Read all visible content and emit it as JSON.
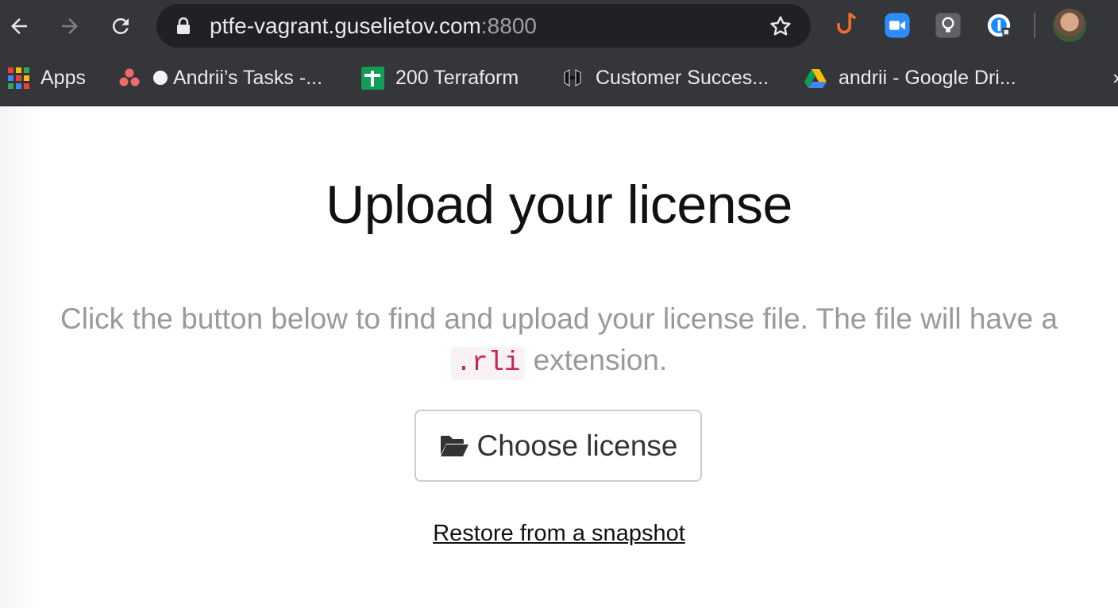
{
  "browser": {
    "url_host": "ptfe-vagrant.guselietov.com",
    "url_port": ":8800",
    "icons": [
      "back-arrow-icon",
      "forward-arrow-icon",
      "reload-icon",
      "lock-icon",
      "bookmark-star-icon",
      "hook-extension-icon",
      "zoom-extension-icon",
      "lightbulb-extension-icon",
      "password-manager-extension-icon",
      "profile-avatar"
    ]
  },
  "bookmarks": [
    {
      "label": "Apps",
      "icon": "apps-grid-icon"
    },
    {
      "label": "Andrii’s Tasks -...",
      "icon": "asana-icon"
    },
    {
      "label": "200 Terraform",
      "icon": "sheets-icon"
    },
    {
      "label": "Customer Succes...",
      "icon": "hashicorp-icon"
    },
    {
      "label": "andrii - Google Dri...",
      "icon": "google-drive-icon"
    }
  ],
  "main": {
    "title": "Upload your license",
    "description_before": "Click the button below to find and upload your license file. The file will have a",
    "extension": ".rli",
    "description_after": "extension.",
    "choose_button": "Choose license",
    "restore_link": "Restore from a snapshot"
  },
  "colors": {
    "toolbar_bg": "#35363a",
    "omnibox_bg": "#202124",
    "code_text": "#c7254e",
    "code_bg": "#f9f2f4",
    "description_text": "#999999"
  }
}
